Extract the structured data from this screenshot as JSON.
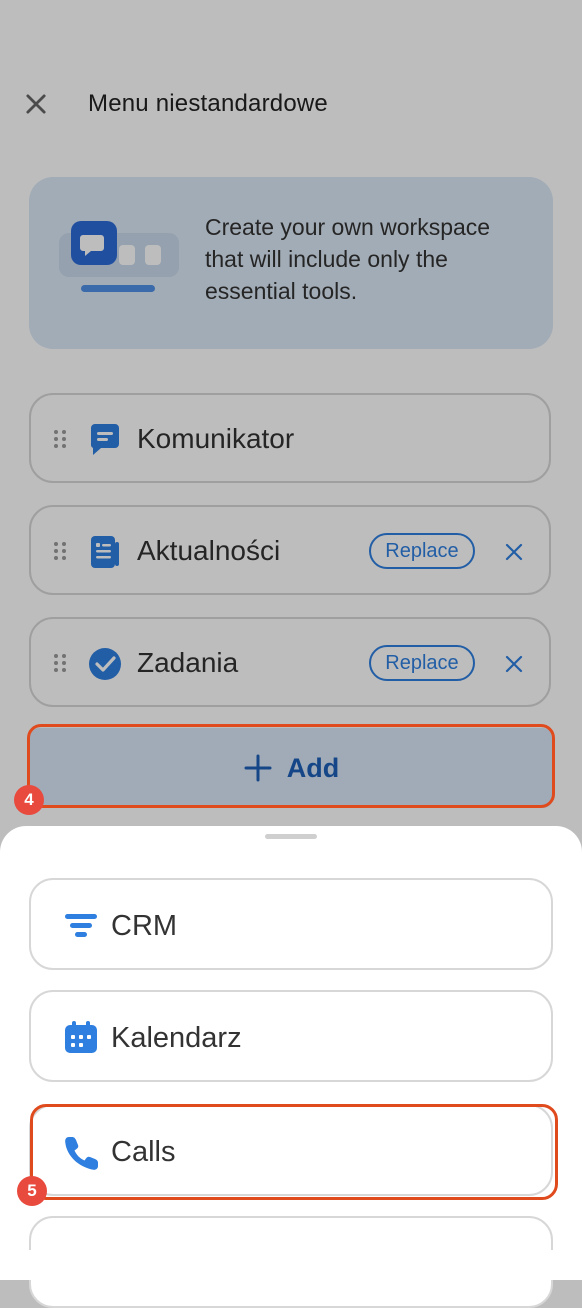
{
  "header": {
    "title": "Menu niestandardowe"
  },
  "banner": {
    "text": "Create your own workspace that will include only the essential tools."
  },
  "menu_items": [
    {
      "label": "Komunikator"
    },
    {
      "label": "Aktualności",
      "replace_label": "Replace"
    },
    {
      "label": "Zadania",
      "replace_label": "Replace"
    }
  ],
  "add_button": {
    "label": "Add"
  },
  "sheet_options": [
    {
      "label": "CRM"
    },
    {
      "label": "Kalendarz"
    },
    {
      "label": "Calls"
    }
  ],
  "annotations": {
    "step_add": "4",
    "step_calls": "5"
  },
  "colors": {
    "accent": "#2f7fe0",
    "highlight": "#e04b1e",
    "badge": "#e94a3e"
  },
  "icons": [
    "close-icon",
    "chat-icon",
    "news-icon",
    "check-icon",
    "plus-icon",
    "crm-filter-icon",
    "calendar-icon",
    "phone-icon"
  ]
}
